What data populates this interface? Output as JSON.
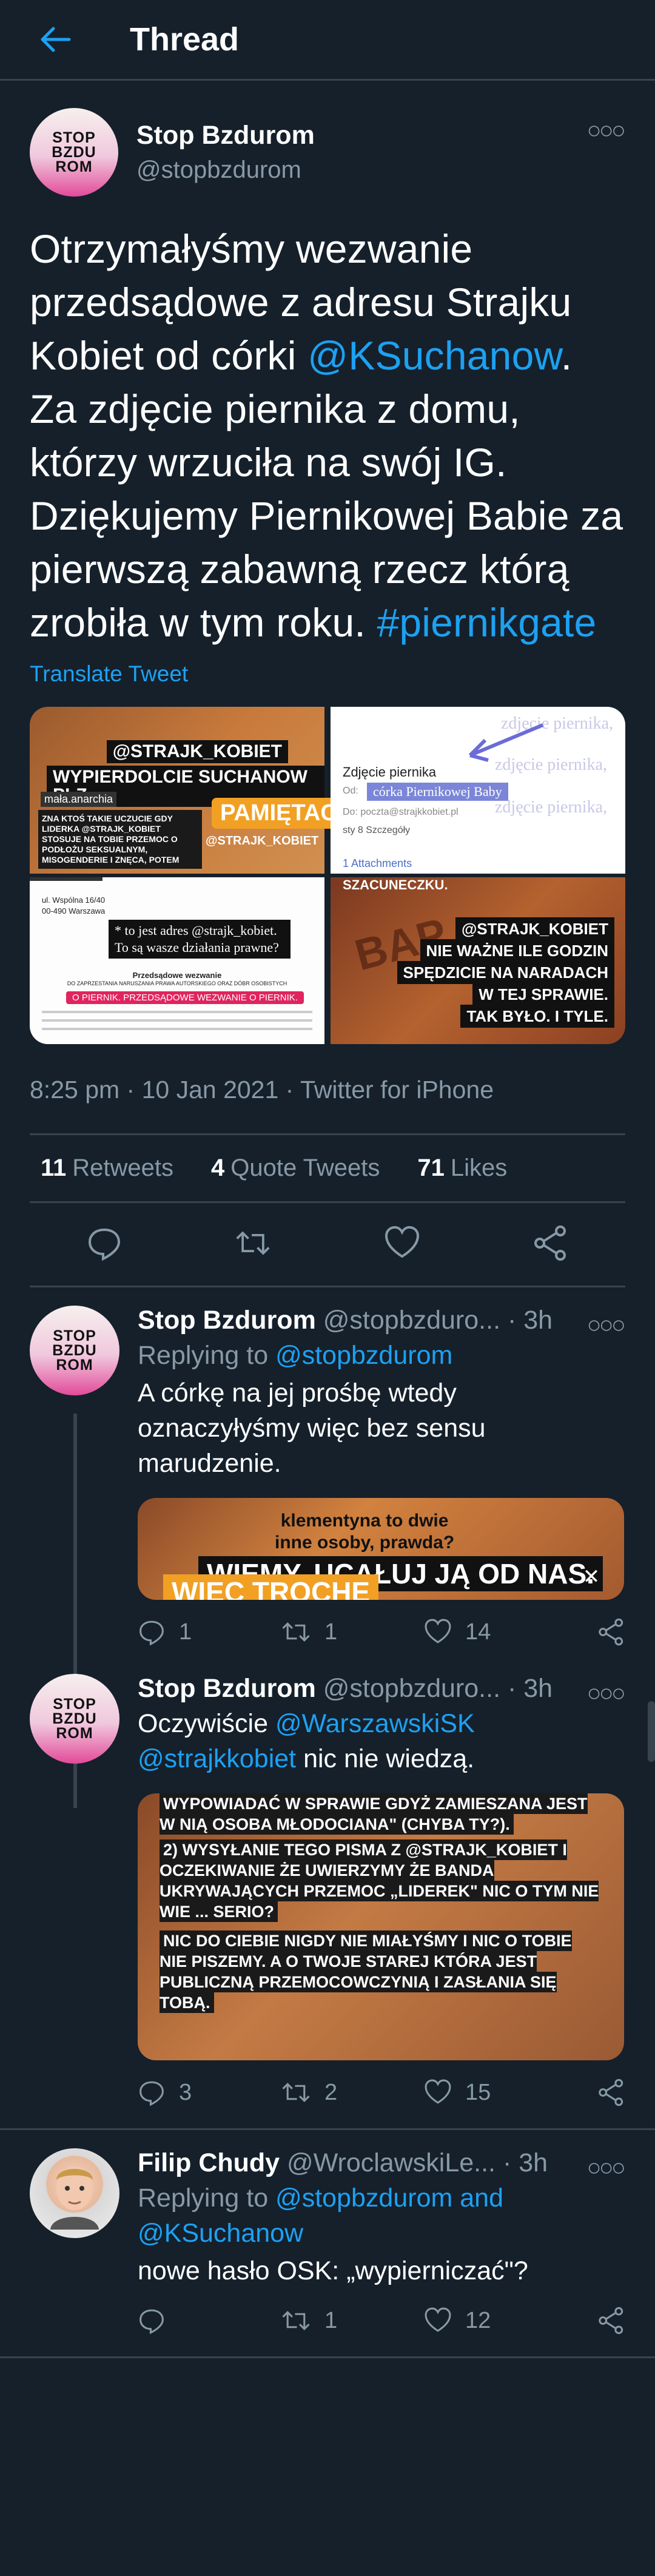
{
  "header": {
    "title": "Thread",
    "back_label": "←"
  },
  "main_tweet": {
    "name": "Stop Bzdurom",
    "handle": "@stopbzdurom",
    "logo_text": [
      "STOP",
      "BZDU",
      "ROM"
    ],
    "text_part1": "Otrzymałyśmy wezwanie przedsądowe z adresu Strajku Kobiet od córki ",
    "mention": "@KSuchanow",
    "text_part2": ". Za zdjęcie piernika z domu, którzy wrzuciła na swój IG. Dziękujemy Piernikowej Babie za pierwszą zabawną rzecz którą zrobiła w tym roku. ",
    "hashtag": "#piernikgate",
    "translate": "Translate Tweet",
    "media": {
      "img1": {
        "cap1": "@STRAJK_KOBIET",
        "cap2": "WYPIERDOLCIE SUCHANOW PLZ",
        "cap3": "mała.anarchia",
        "pill": "PAMIĘTACIE?",
        "cap4": "ZNA KTOŚ TAKIE UCZUCIE GDY LIDERKA @STRAJK_KOBIET STOSUJE NA TOBIE PRZEMOC O PODŁOŻU SEKSUALNYM, MISOGENDERIE I ZNĘCA, POTEM",
        "cap5": "@STRAJK_KOBIET"
      },
      "img2": {
        "title": "Zdjęcie piernika",
        "chip": "córka Piernikowej Baby",
        "from": "Od:",
        "to": "Do: poczta@strajkkobiet.pl",
        "att": "1 Attachments",
        "sty": "sty 8 Szczegóły",
        "ghost": "zdjęcie piernika,"
      },
      "img3": {
        "addr1": "ul. Wspólna 16/40",
        "addr2": "00-490 Warszawa",
        "note": "* to jest adres @strajk_kobiet. To są wasze działania prawne?",
        "head": "Przedsądowe wezwanie",
        "sub": "DO ZAPRZESTANIA NARUSZANIA PRAWA AUTORSKIEGO ORAZ DÓBR OSOBISTYCH",
        "redbar": "O PIERNIK. PRZEDSĄDOWE WEZWANIE O PIERNIK."
      },
      "img4": {
        "top": "SZACUNECZKU.",
        "cap1": "@STRAJK_KOBIET",
        "cap2": "NIE WAŻNE ILE GODZIN",
        "cap3": "SPĘDZICIE NA NARADACH",
        "cap4": "W TEJ SPRAWIE.",
        "cap5": "TAK BYŁO. I TYLE."
      }
    },
    "time": "8:25 pm · 10 Jan 2021 · Twitter for iPhone",
    "stats": {
      "retweets_n": "11",
      "retweets_l": "Retweets",
      "quotes_n": "4",
      "quotes_l": "Quote Tweets",
      "likes_n": "71",
      "likes_l": "Likes"
    }
  },
  "replies": [
    {
      "name": "Stop Bzdurom",
      "handle": "@stopbzduro...",
      "time": "· 3h",
      "replying_label": "Replying to ",
      "replying_to": "@stopbzdurom",
      "text": "A córkę na jej prośbę wtedy oznaczyłyśmy więc bez sensu marudzenie.",
      "media": {
        "t1": "klementyna to dwie",
        "t2": "inne osoby, prawda?",
        "t3": "WIEMY. UCAŁUJ JĄ OD NAS.",
        "t4": "WIEC TROCHE"
      },
      "replies_count": "1",
      "retweets_count": "1",
      "likes_count": "14"
    },
    {
      "name": "Stop Bzdurom",
      "handle": "@stopbzduro...",
      "time": "· 3h",
      "text_pre": "Oczywiście ",
      "mention1": "@WarszawskiSK",
      "mention2": "@strajkkobiet",
      "text_post": " nic nie wiedzą.",
      "media": {
        "l1": "WYPOWIADAĆ W SPRAWIE GDYŻ ZAMIESZANA JEST W NIĄ OSOBA MŁODOCIANA\" (CHYBA TY?).",
        "l2": "2) WYSYŁANIE TEGO PISMA Z @STRAJK_KOBIET I OCZEKIWANIE ŻE UWIERZYMY ŻE BANDA UKRYWAJĄCYCH PRZEMOC „LIDEREK\" NIC O TYM NIE WIE ... SERIO?",
        "l3": "NIC DO CIEBIE NIGDY NIE MIAŁYŚMY I NIC O TOBIE NIE PISZEMY. A O TWOJE STAREJ KTÓRA JEST PUBLICZNĄ PRZEMOCOWCZYNIĄ I ZASŁANIA SIĘ TOBĄ."
      },
      "replies_count": "3",
      "retweets_count": "2",
      "likes_count": "15"
    },
    {
      "name": "Filip Chudy",
      "handle": "@WroclawskiLe...",
      "time": "· 3h",
      "replying_label": "Replying to ",
      "replying_to": "@stopbzdurom and @KSuchanow",
      "text": "nowe hasło OSK: „wypierniczać\"?",
      "replies_count": "",
      "retweets_count": "1",
      "likes_count": "12"
    }
  ]
}
